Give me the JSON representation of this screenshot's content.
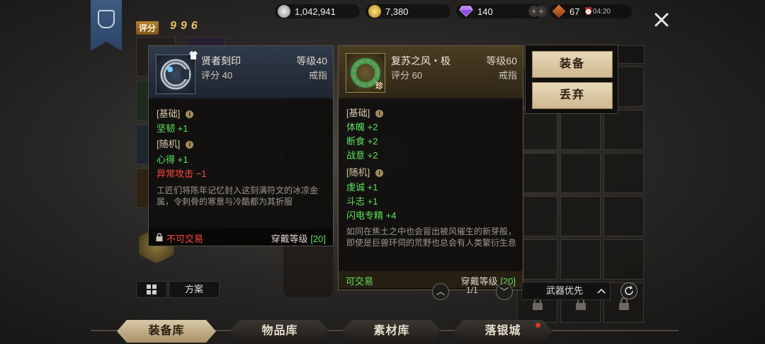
{
  "resources": {
    "silver": "1,042,941",
    "gold": "7,380",
    "gems": "140",
    "stamina": "67",
    "timer": "04:20"
  },
  "score": {
    "tag": "评分",
    "value": "996"
  },
  "left_card": {
    "name": "贤者刻印",
    "level": "等级40",
    "score": "评分 40",
    "type": "戒指",
    "base_title": "[基础]",
    "base_stats": [
      {
        "text": "坚韧 +1",
        "color": "green"
      }
    ],
    "random_title": "[随机]",
    "random_stats": [
      {
        "text": "心得 +1",
        "color": "green"
      },
      {
        "text": "异常攻击 −1",
        "color": "red"
      }
    ],
    "description": "工匠们将陈年记忆封入这刻满符文的冰凉金属，令刺骨的寒意与冷酷都为其折服",
    "trade": "不可交易",
    "wear_label": "穿戴等级",
    "wear_level": "[20]"
  },
  "right_card": {
    "name": "复苏之风・极",
    "level": "等级60",
    "score": "评分 60",
    "type": "戒指",
    "badge": "珍",
    "base_title": "[基础]",
    "base_stats": [
      {
        "text": "体魄 +2",
        "color": "green"
      },
      {
        "text": "断食 +2",
        "color": "green"
      },
      {
        "text": "战意 +2",
        "color": "green"
      }
    ],
    "random_title": "[随机]",
    "random_stats": [
      {
        "text": "虔诚 +1",
        "color": "green"
      },
      {
        "text": "斗志 +1",
        "color": "green"
      },
      {
        "text": "闪电专精 +4",
        "color": "green"
      }
    ],
    "description": "如同在焦土之中也会冒出被风催生的新芽般，即使是巨兽环伺的荒野也总会有人类繁衍生息",
    "trade": "可交易",
    "wear_label": "穿戴等级",
    "wear_level": "[20]"
  },
  "actions": {
    "equip": "装备",
    "discard": "丢弃"
  },
  "controls": {
    "scheme": "方案",
    "page": "1/1",
    "sort": "武器优先"
  },
  "tabs": [
    "装备库",
    "物品库",
    "素材库",
    "落银城"
  ],
  "colors": {
    "stat_green": "#5fe25a",
    "stat_red": "#ff4a3c",
    "accent_gold": "#e7c06a"
  }
}
